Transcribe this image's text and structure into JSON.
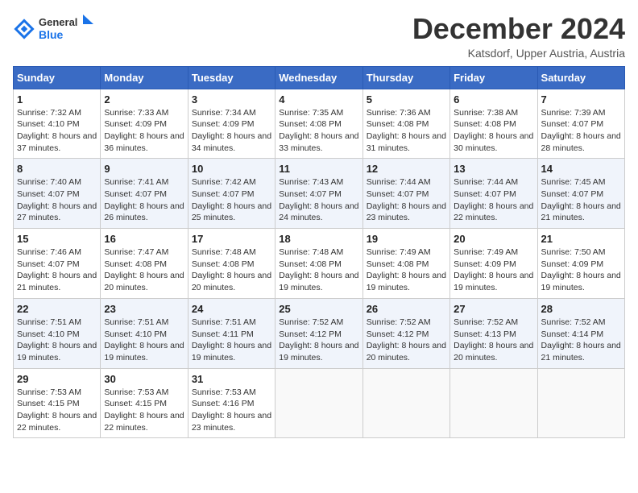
{
  "header": {
    "logo": {
      "general": "General",
      "blue": "Blue"
    },
    "title": "December 2024",
    "location": "Katsdorf, Upper Austria, Austria"
  },
  "calendar": {
    "days_of_week": [
      "Sunday",
      "Monday",
      "Tuesday",
      "Wednesday",
      "Thursday",
      "Friday",
      "Saturday"
    ],
    "weeks": [
      [
        {
          "day": "1",
          "sunrise": "7:32 AM",
          "sunset": "4:10 PM",
          "daylight": "8 hours and 37 minutes."
        },
        {
          "day": "2",
          "sunrise": "7:33 AM",
          "sunset": "4:09 PM",
          "daylight": "8 hours and 36 minutes."
        },
        {
          "day": "3",
          "sunrise": "7:34 AM",
          "sunset": "4:09 PM",
          "daylight": "8 hours and 34 minutes."
        },
        {
          "day": "4",
          "sunrise": "7:35 AM",
          "sunset": "4:08 PM",
          "daylight": "8 hours and 33 minutes."
        },
        {
          "day": "5",
          "sunrise": "7:36 AM",
          "sunset": "4:08 PM",
          "daylight": "8 hours and 31 minutes."
        },
        {
          "day": "6",
          "sunrise": "7:38 AM",
          "sunset": "4:08 PM",
          "daylight": "8 hours and 30 minutes."
        },
        {
          "day": "7",
          "sunrise": "7:39 AM",
          "sunset": "4:07 PM",
          "daylight": "8 hours and 28 minutes."
        }
      ],
      [
        {
          "day": "8",
          "sunrise": "7:40 AM",
          "sunset": "4:07 PM",
          "daylight": "8 hours and 27 minutes."
        },
        {
          "day": "9",
          "sunrise": "7:41 AM",
          "sunset": "4:07 PM",
          "daylight": "8 hours and 26 minutes."
        },
        {
          "day": "10",
          "sunrise": "7:42 AM",
          "sunset": "4:07 PM",
          "daylight": "8 hours and 25 minutes."
        },
        {
          "day": "11",
          "sunrise": "7:43 AM",
          "sunset": "4:07 PM",
          "daylight": "8 hours and 24 minutes."
        },
        {
          "day": "12",
          "sunrise": "7:44 AM",
          "sunset": "4:07 PM",
          "daylight": "8 hours and 23 minutes."
        },
        {
          "day": "13",
          "sunrise": "7:44 AM",
          "sunset": "4:07 PM",
          "daylight": "8 hours and 22 minutes."
        },
        {
          "day": "14",
          "sunrise": "7:45 AM",
          "sunset": "4:07 PM",
          "daylight": "8 hours and 21 minutes."
        }
      ],
      [
        {
          "day": "15",
          "sunrise": "7:46 AM",
          "sunset": "4:07 PM",
          "daylight": "8 hours and 21 minutes."
        },
        {
          "day": "16",
          "sunrise": "7:47 AM",
          "sunset": "4:08 PM",
          "daylight": "8 hours and 20 minutes."
        },
        {
          "day": "17",
          "sunrise": "7:48 AM",
          "sunset": "4:08 PM",
          "daylight": "8 hours and 20 minutes."
        },
        {
          "day": "18",
          "sunrise": "7:48 AM",
          "sunset": "4:08 PM",
          "daylight": "8 hours and 19 minutes."
        },
        {
          "day": "19",
          "sunrise": "7:49 AM",
          "sunset": "4:08 PM",
          "daylight": "8 hours and 19 minutes."
        },
        {
          "day": "20",
          "sunrise": "7:49 AM",
          "sunset": "4:09 PM",
          "daylight": "8 hours and 19 minutes."
        },
        {
          "day": "21",
          "sunrise": "7:50 AM",
          "sunset": "4:09 PM",
          "daylight": "8 hours and 19 minutes."
        }
      ],
      [
        {
          "day": "22",
          "sunrise": "7:51 AM",
          "sunset": "4:10 PM",
          "daylight": "8 hours and 19 minutes."
        },
        {
          "day": "23",
          "sunrise": "7:51 AM",
          "sunset": "4:10 PM",
          "daylight": "8 hours and 19 minutes."
        },
        {
          "day": "24",
          "sunrise": "7:51 AM",
          "sunset": "4:11 PM",
          "daylight": "8 hours and 19 minutes."
        },
        {
          "day": "25",
          "sunrise": "7:52 AM",
          "sunset": "4:12 PM",
          "daylight": "8 hours and 19 minutes."
        },
        {
          "day": "26",
          "sunrise": "7:52 AM",
          "sunset": "4:12 PM",
          "daylight": "8 hours and 20 minutes."
        },
        {
          "day": "27",
          "sunrise": "7:52 AM",
          "sunset": "4:13 PM",
          "daylight": "8 hours and 20 minutes."
        },
        {
          "day": "28",
          "sunrise": "7:52 AM",
          "sunset": "4:14 PM",
          "daylight": "8 hours and 21 minutes."
        }
      ],
      [
        {
          "day": "29",
          "sunrise": "7:53 AM",
          "sunset": "4:15 PM",
          "daylight": "8 hours and 22 minutes."
        },
        {
          "day": "30",
          "sunrise": "7:53 AM",
          "sunset": "4:15 PM",
          "daylight": "8 hours and 22 minutes."
        },
        {
          "day": "31",
          "sunrise": "7:53 AM",
          "sunset": "4:16 PM",
          "daylight": "8 hours and 23 minutes."
        },
        null,
        null,
        null,
        null
      ]
    ]
  }
}
